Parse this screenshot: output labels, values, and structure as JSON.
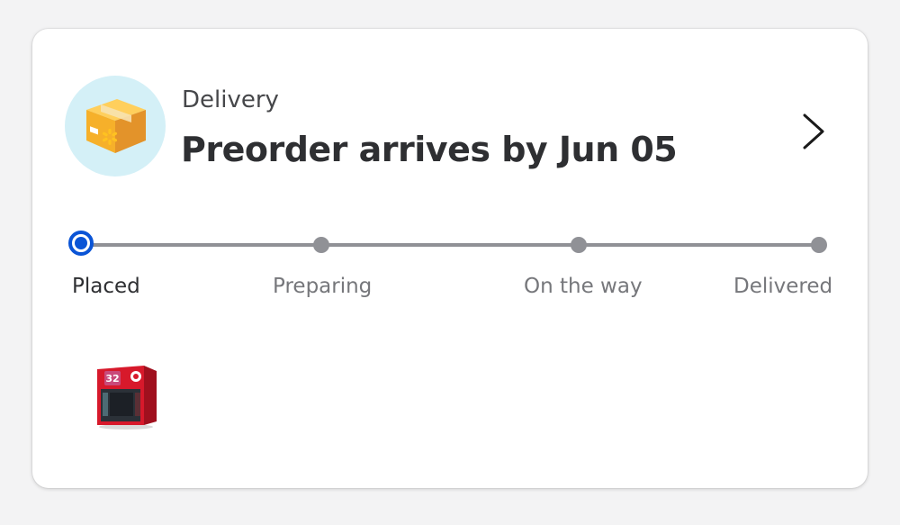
{
  "delivery": {
    "label": "Delivery",
    "title": "Preorder arrives by Jun 05",
    "icon": "package-box-icon",
    "open_details_icon": "chevron-right-icon"
  },
  "progress": {
    "steps": [
      {
        "label": "Placed",
        "state": "active"
      },
      {
        "label": "Preparing",
        "state": "pending"
      },
      {
        "label": "On the way",
        "state": "pending"
      },
      {
        "label": "Delivered",
        "state": "pending"
      }
    ],
    "current_step_index": 0
  },
  "items": [
    {
      "type": "product-thumbnail",
      "box_text": "32"
    }
  ],
  "colors": {
    "accent": "#0a54d6",
    "track": "#909196",
    "avatar_bg": "#d4f0f7",
    "box": "#f6b02a",
    "spark": "#ffc220"
  }
}
